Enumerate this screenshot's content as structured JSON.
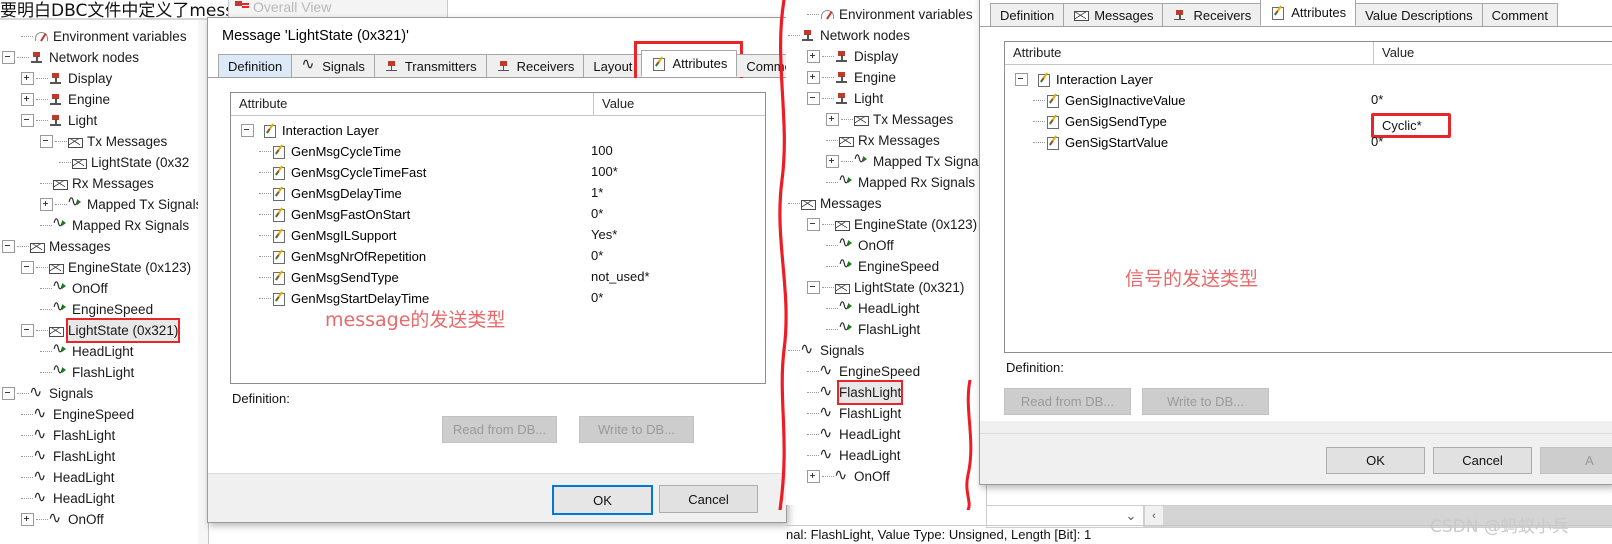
{
  "top": {
    "page_title": "要明白DBC文件中定义了mess",
    "overall_view_title": "Overall View"
  },
  "left_tree": {
    "items": [
      {
        "label": "Environment variables",
        "icon": "env-icon",
        "indent": 1,
        "toggle": "none"
      },
      {
        "label": "Network nodes",
        "icon": "ecu-node-icon",
        "indent": 0,
        "toggle": "minus"
      },
      {
        "label": "Display",
        "icon": "ecu-node-icon",
        "indent": 1,
        "toggle": "plus"
      },
      {
        "label": "Engine",
        "icon": "ecu-node-icon",
        "indent": 1,
        "toggle": "plus"
      },
      {
        "label": "Light",
        "icon": "ecu-node-icon",
        "indent": 1,
        "toggle": "minus"
      },
      {
        "label": "Tx Messages",
        "icon": "message-icon",
        "indent": 2,
        "toggle": "minus"
      },
      {
        "label": "LightState (0x32",
        "icon": "message-icon",
        "indent": 3,
        "toggle": "none"
      },
      {
        "label": "Rx Messages",
        "icon": "message-icon",
        "indent": 2,
        "toggle": "none"
      },
      {
        "label": "Mapped Tx Signals",
        "icon": "mapped-signal-icon",
        "indent": 2,
        "toggle": "plus"
      },
      {
        "label": "Mapped Rx Signals",
        "icon": "mapped-signal-icon",
        "indent": 2,
        "toggle": "none"
      },
      {
        "label": "Messages",
        "icon": "message-icon",
        "indent": 0,
        "toggle": "minus"
      },
      {
        "label": "EngineState (0x123)",
        "icon": "message-icon",
        "indent": 1,
        "toggle": "minus"
      },
      {
        "label": "OnOff",
        "icon": "mapped-signal-icon",
        "indent": 2,
        "toggle": "none"
      },
      {
        "label": "EngineSpeed",
        "icon": "mapped-signal-icon",
        "indent": 2,
        "toggle": "none"
      },
      {
        "label": "LightState (0x321)",
        "icon": "message-icon",
        "indent": 1,
        "toggle": "minus",
        "selected": true,
        "highlight": true
      },
      {
        "label": "HeadLight",
        "icon": "mapped-signal-icon",
        "indent": 2,
        "toggle": "none"
      },
      {
        "label": "FlashLight",
        "icon": "mapped-signal-icon",
        "indent": 2,
        "toggle": "none"
      },
      {
        "label": "Signals",
        "icon": "signal-icon",
        "indent": 0,
        "toggle": "minus"
      },
      {
        "label": "EngineSpeed",
        "icon": "signal-icon",
        "indent": 1,
        "toggle": "none"
      },
      {
        "label": "FlashLight",
        "icon": "signal-icon",
        "indent": 1,
        "toggle": "none"
      },
      {
        "label": "FlashLight",
        "icon": "signal-icon",
        "indent": 1,
        "toggle": "none"
      },
      {
        "label": "HeadLight",
        "icon": "signal-icon",
        "indent": 1,
        "toggle": "none"
      },
      {
        "label": "HeadLight",
        "icon": "signal-icon",
        "indent": 1,
        "toggle": "none"
      },
      {
        "label": "OnOff",
        "icon": "signal-icon",
        "indent": 1,
        "toggle": "plus"
      }
    ]
  },
  "right_tree": {
    "items": [
      {
        "label": "Environment variables",
        "icon": "env-icon",
        "indent": 1,
        "toggle": "none"
      },
      {
        "label": "Network nodes",
        "icon": "ecu-node-icon",
        "indent": 0,
        "toggle": "none"
      },
      {
        "label": "Display",
        "icon": "ecu-node-icon",
        "indent": 1,
        "toggle": "plus"
      },
      {
        "label": "Engine",
        "icon": "ecu-node-icon",
        "indent": 1,
        "toggle": "plus"
      },
      {
        "label": "Light",
        "icon": "ecu-node-icon",
        "indent": 1,
        "toggle": "minus"
      },
      {
        "label": "Tx Messages",
        "icon": "message-icon",
        "indent": 2,
        "toggle": "plus"
      },
      {
        "label": "Rx Messages",
        "icon": "message-icon",
        "indent": 2,
        "toggle": "none"
      },
      {
        "label": "Mapped Tx Signals",
        "icon": "mapped-signal-icon",
        "indent": 2,
        "toggle": "plus"
      },
      {
        "label": "Mapped Rx Signals",
        "icon": "mapped-signal-icon",
        "indent": 2,
        "toggle": "none"
      },
      {
        "label": "Messages",
        "icon": "message-icon",
        "indent": 0,
        "toggle": "none"
      },
      {
        "label": "EngineState (0x123)",
        "icon": "message-icon",
        "indent": 1,
        "toggle": "minus"
      },
      {
        "label": "OnOff",
        "icon": "mapped-signal-icon",
        "indent": 2,
        "toggle": "none"
      },
      {
        "label": "EngineSpeed",
        "icon": "mapped-signal-icon",
        "indent": 2,
        "toggle": "none"
      },
      {
        "label": "LightState (0x321)",
        "icon": "message-icon",
        "indent": 1,
        "toggle": "minus"
      },
      {
        "label": "HeadLight",
        "icon": "mapped-signal-icon",
        "indent": 2,
        "toggle": "none"
      },
      {
        "label": "FlashLight",
        "icon": "mapped-signal-icon",
        "indent": 2,
        "toggle": "none"
      },
      {
        "label": "Signals",
        "icon": "signal-icon",
        "indent": 0,
        "toggle": "none"
      },
      {
        "label": "EngineSpeed",
        "icon": "signal-icon",
        "indent": 1,
        "toggle": "none"
      },
      {
        "label": "FlashLight",
        "icon": "signal-icon",
        "indent": 1,
        "toggle": "none",
        "selected": true,
        "highlight": true
      },
      {
        "label": "FlashLight",
        "icon": "signal-icon",
        "indent": 1,
        "toggle": "none"
      },
      {
        "label": "HeadLight",
        "icon": "signal-icon",
        "indent": 1,
        "toggle": "none"
      },
      {
        "label": "HeadLight",
        "icon": "signal-icon",
        "indent": 1,
        "toggle": "none"
      },
      {
        "label": "OnOff",
        "icon": "signal-icon",
        "indent": 1,
        "toggle": "plus"
      }
    ]
  },
  "message_dialog": {
    "title": "Message 'LightState (0x321)'",
    "tabs": [
      {
        "label": "Definition",
        "icon": null,
        "state": "selected-blue"
      },
      {
        "label": "Signals",
        "icon": "signal-icon",
        "state": "normal"
      },
      {
        "label": "Transmitters",
        "icon": "ecu-node-icon",
        "state": "normal"
      },
      {
        "label": "Receivers",
        "icon": "ecu-node-icon",
        "state": "normal"
      },
      {
        "label": "Layout",
        "icon": null,
        "state": "normal"
      },
      {
        "label": "Attributes",
        "icon": "attribute-icon",
        "state": "active",
        "highlight": true
      },
      {
        "label": "Comment",
        "icon": null,
        "state": "normal"
      }
    ],
    "grid": {
      "col_attribute": "Attribute",
      "col_value": "Value",
      "group": {
        "label": "Interaction Layer",
        "icon": "attribute-icon",
        "toggle": "minus"
      },
      "rows": [
        {
          "attribute": "GenMsgCycleTime",
          "value": "100"
        },
        {
          "attribute": "GenMsgCycleTimeFast",
          "value": "100*"
        },
        {
          "attribute": "GenMsgDelayTime",
          "value": "1*"
        },
        {
          "attribute": "GenMsgFastOnStart",
          "value": "0*"
        },
        {
          "attribute": "GenMsgILSupport",
          "value": "Yes*"
        },
        {
          "attribute": "GenMsgNrOfRepetition",
          "value": "0*"
        },
        {
          "attribute": "GenMsgSendType",
          "value": "not_used*"
        },
        {
          "attribute": "GenMsgStartDelayTime",
          "value": "0*"
        }
      ]
    },
    "annotation": "message的发送类型",
    "definition_label": "Definition:",
    "read_button": "Read from DB...",
    "write_button": "Write to DB...",
    "ok_button": "OK",
    "cancel_button": "Cancel"
  },
  "signal_dialog": {
    "tabs": [
      {
        "label": "Definition",
        "icon": null,
        "state": "normal"
      },
      {
        "label": "Messages",
        "icon": "message-icon",
        "state": "normal"
      },
      {
        "label": "Receivers",
        "icon": "ecu-node-icon",
        "state": "normal"
      },
      {
        "label": "Attributes",
        "icon": "attribute-icon",
        "state": "active"
      },
      {
        "label": "Value Descriptions",
        "icon": null,
        "state": "normal"
      },
      {
        "label": "Comment",
        "icon": null,
        "state": "normal"
      }
    ],
    "grid": {
      "col_attribute": "Attribute",
      "col_value": "Value",
      "group": {
        "label": "Interaction Layer",
        "icon": "attribute-icon",
        "toggle": "minus"
      },
      "rows": [
        {
          "attribute": "GenSigInactiveValue",
          "value": "0*",
          "highlight": false
        },
        {
          "attribute": "GenSigSendType",
          "value": "Cyclic*",
          "highlight": true
        },
        {
          "attribute": "GenSigStartValue",
          "value": "0*",
          "highlight": false
        }
      ]
    },
    "annotation": "信号的发送类型",
    "definition_label": "Definition:",
    "read_button": "Read from DB...",
    "write_button": "Write to DB...",
    "ok_button": "OK",
    "cancel_button": "Cancel",
    "apply_button": "A"
  },
  "statusbar": {
    "text": "nal: FlashLight,    Value Type: Unsigned,    Length [Bit]: 1"
  },
  "watermark": "CSDN @蚂蚁小兵",
  "colors": {
    "highlight_red": "#e8262a",
    "annotation_red": "#e8696b",
    "accent_blue": "#0078d7",
    "selection_gray": "#e8e8e8"
  }
}
